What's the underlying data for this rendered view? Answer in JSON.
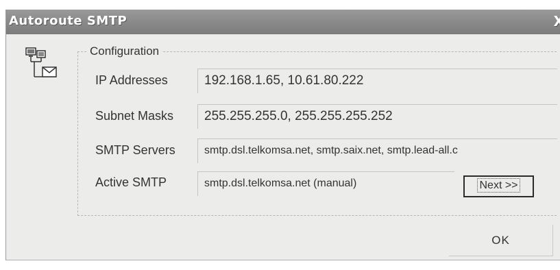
{
  "window": {
    "title": "Autoroute SMTP",
    "close_glyph": "X",
    "icon": "network-mail-icon"
  },
  "configuration": {
    "legend": "Configuration",
    "rows": [
      {
        "label": "IP Addresses",
        "value": "192.168.1.65, 10.61.80.222"
      },
      {
        "label": "Subnet Masks",
        "value": "255.255.255.0, 255.255.255.252"
      },
      {
        "label": "SMTP Servers",
        "value": "smtp.dsl.telkomsa.net, smtp.saix.net, smtp.lead-all.c"
      },
      {
        "label": "Active SMTP",
        "value": "smtp.dsl.telkomsa.net (manual)"
      }
    ],
    "next_label": "Next >>"
  },
  "footer": {
    "ok_label": "OK"
  }
}
